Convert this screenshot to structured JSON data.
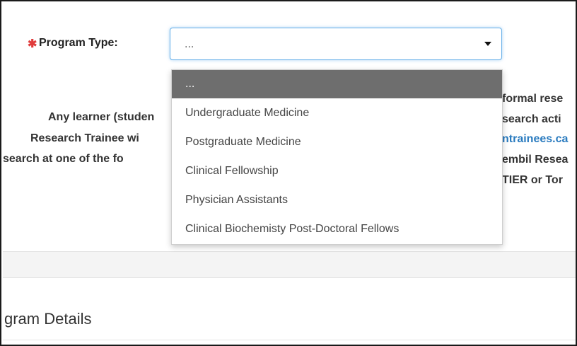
{
  "form": {
    "program_label": "Program Type:",
    "select": {
      "value": "...",
      "options": [
        "...",
        "Undergraduate Medicine",
        "Postgraduate Medicine",
        "Clinical Fellowship",
        "Physician Assistants",
        "Clinical Biochemisty Post-Doctoral Fellows"
      ],
      "highlighted_index": 0
    }
  },
  "background_text": {
    "left_1": "Any learner (studen",
    "left_2": "Research Trainee wi",
    "left_3": "search at one of the fo",
    "right_1": "formal rese",
    "right_2": "search acti",
    "right_3": "ntrainees.ca",
    "right_4": "embil Resea",
    "right_5": "TIER or Tor"
  },
  "section": {
    "title": "gram Details"
  },
  "colors": {
    "required_star": "#e03b3b",
    "select_focus_border": "#66afe9",
    "highlighted_option_bg": "#6e6e6e",
    "link": "#2a7bbf"
  },
  "icons": {
    "required": "required-star-icon",
    "dropdown": "caret-down-icon"
  }
}
